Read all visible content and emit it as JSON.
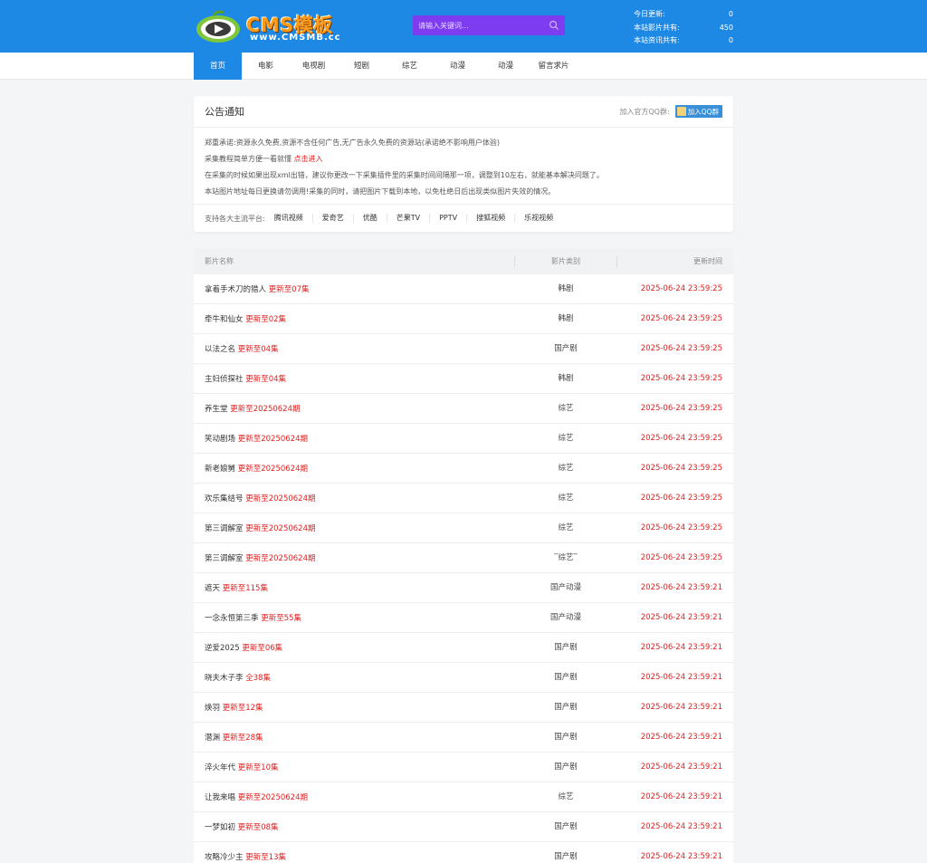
{
  "header": {
    "logo_title": "CMS模板",
    "logo_url": "www.CMSMB.cc",
    "search_placeholder": "请输入关键词...",
    "stats": [
      {
        "label": "今日更新:",
        "value": "0"
      },
      {
        "label": "本站影片共有:",
        "value": "450"
      },
      {
        "label": "本站资讯共有:",
        "value": "0"
      }
    ]
  },
  "nav": [
    "首页",
    "电影",
    "电视剧",
    "短剧",
    "综艺",
    "动漫",
    "动漫",
    "留言求片"
  ],
  "notice": {
    "title": "公告通知",
    "qq_label": "加入官方QQ群:",
    "qq_button": "加入QQ群",
    "lines": [
      {
        "text": "郑重承诺:资源永久免费,资源不含任何广告,无广告永久免费的资源站(承诺绝不影响用户体验)",
        "link": ""
      },
      {
        "text": "采集教程简单方便一看就懂 ",
        "link": "点击进入"
      },
      {
        "text": "在采集的时候如果出现xml出错，建议你更改一下采集插件里的采集时间间隔那一项，调整到10左右，就能基本解决问题了。",
        "link": ""
      },
      {
        "text": "本站图片地址每日更换请勿调用!采集的同时，请把图片下载到本地，以免杜绝日后出现类似图片失效的情况。",
        "link": ""
      }
    ],
    "platform_label": "支持各大主流平台:",
    "platforms": [
      "腾讯视频",
      "爱奇艺",
      "优酷",
      "芒果TV",
      "PPTV",
      "搜狐视频",
      "乐视视频"
    ]
  },
  "table": {
    "headers": [
      "影片名称",
      "影片类别",
      "更新时间"
    ],
    "rows": [
      {
        "name": "拿着手术刀的猎人",
        "update": "更新至07集",
        "cat": "韩剧",
        "time": "2025-06-24 23:59:25"
      },
      {
        "name": "牵牛和仙女",
        "update": "更新至02集",
        "cat": "韩剧",
        "time": "2025-06-24 23:59:25"
      },
      {
        "name": "以法之名",
        "update": "更新至04集",
        "cat": "国产剧",
        "time": "2025-06-24 23:59:25"
      },
      {
        "name": "主妇侦探社",
        "update": "更新至04集",
        "cat": "韩剧",
        "time": "2025-06-24 23:59:25"
      },
      {
        "name": "养生堂",
        "update": "更新至20250624期",
        "cat": "综艺",
        "time": "2025-06-24 23:59:25"
      },
      {
        "name": "笑动剧场",
        "update": "更新至20250624期",
        "cat": "综艺",
        "time": "2025-06-24 23:59:25"
      },
      {
        "name": "新老娘舅",
        "update": "更新至20250624期",
        "cat": "综艺",
        "time": "2025-06-24 23:59:25"
      },
      {
        "name": "欢乐集结号",
        "update": "更新至20250624期",
        "cat": "综艺",
        "time": "2025-06-24 23:59:25"
      },
      {
        "name": "第三调解室",
        "update": "更新至20250624期",
        "cat": "综艺",
        "time": "2025-06-24 23:59:25"
      },
      {
        "name": "第三调解室",
        "update": "更新至20250624期",
        "cat": "‾综艺‾",
        "time": "2025-06-24 23:59:25"
      },
      {
        "name": "遮天",
        "update": "更新至115集",
        "cat": "国产动漫",
        "time": "2025-06-24 23:59:21"
      },
      {
        "name": "一念永恒第三季",
        "update": "更新至55集",
        "cat": "国产动漫",
        "time": "2025-06-24 23:59:21"
      },
      {
        "name": "逆爱2025",
        "update": "更新至06集",
        "cat": "国产剧",
        "time": "2025-06-24 23:59:21"
      },
      {
        "name": "晓夫木子李",
        "update": "全38集",
        "cat": "国产剧",
        "time": "2025-06-24 23:59:21"
      },
      {
        "name": "焕羽",
        "update": "更新至12集",
        "cat": "国产剧",
        "time": "2025-06-24 23:59:21"
      },
      {
        "name": "潜渊",
        "update": "更新至28集",
        "cat": "国产剧",
        "time": "2025-06-24 23:59:21"
      },
      {
        "name": "淬火年代",
        "update": "更新至10集",
        "cat": "国产剧",
        "time": "2025-06-24 23:59:21"
      },
      {
        "name": "让我来唱",
        "update": "更新至20250624期",
        "cat": "综艺",
        "time": "2025-06-24 23:59:21"
      },
      {
        "name": "一梦如初",
        "update": "更新至08集",
        "cat": "国产剧",
        "time": "2025-06-24 23:59:21"
      },
      {
        "name": "攻略冷少主",
        "update": "更新至13集",
        "cat": "国产剧",
        "time": "2025-06-24 23:59:21"
      }
    ]
  }
}
